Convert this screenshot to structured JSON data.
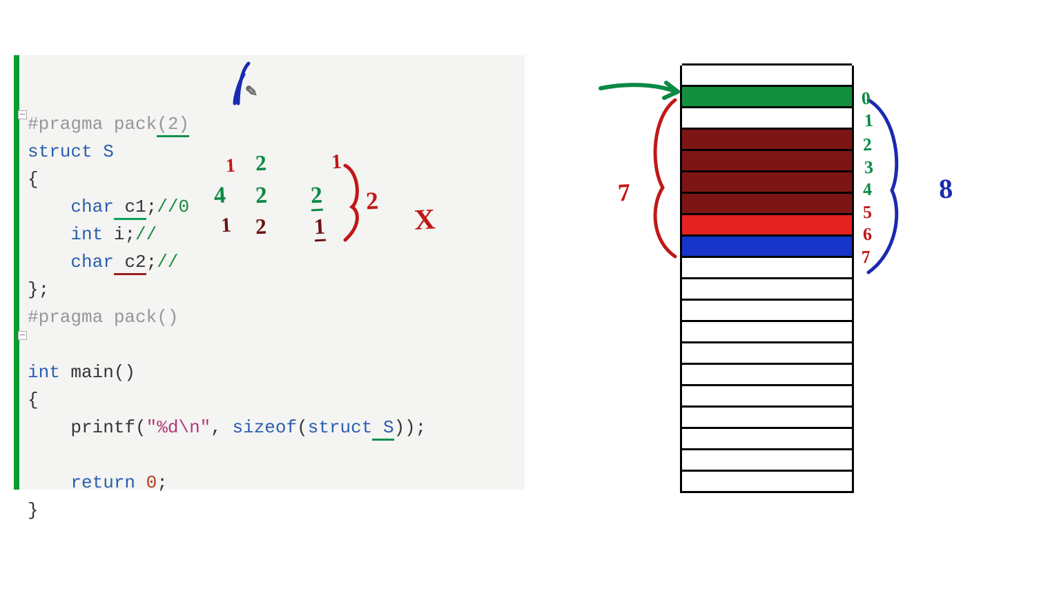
{
  "code": {
    "l1_pragma_open": "#pragma pack",
    "l1_pack_val": "(2)",
    "l2_struct_kw": "struct",
    "l2_struct_name": " S",
    "l3_open": "{",
    "l4_indent": "    ",
    "l4_type": "char",
    "l4_var": " c1",
    "l4_tail": ";",
    "l4_comment": "//0",
    "l5_indent": "    ",
    "l5_type": "int",
    "l5_var": " i;",
    "l5_comment": "//",
    "l6_indent": "    ",
    "l6_type": "char",
    "l6_var": " c2",
    "l6_tail": ";",
    "l6_comment": "//",
    "l7_close": "};",
    "l8_pragma_close": "#pragma pack()",
    "l10_int": "int",
    "l10_main": " main()",
    "l11_open": "{",
    "l12_indent": "    ",
    "l12_printf": "printf",
    "l12_open": "(",
    "l12_fmt": "\"%d\\n\"",
    "l12_comma": ", ",
    "l12_sizeof": "sizeof",
    "l12_p2": "(",
    "l12_struct": "struct",
    "l12_s": " S",
    "l12_tail": "));",
    "l14_indent": "    ",
    "l14_return": "return",
    "l14_zero": " 0",
    "l14_semi": ";",
    "l15_close": "}"
  },
  "annotations": {
    "c1_col1": "1",
    "c1_col2": "2",
    "c1_col3_top": "1",
    "i_col1": "4",
    "i_col2": "2",
    "i_col3": "2",
    "c2_col1": "1",
    "c2_col2": "2",
    "c2_col3": "1",
    "brace_result": "2",
    "cross": "X",
    "cursor_pen": "✎",
    "left_seven": "7",
    "right_eight": "8",
    "mem0": "0",
    "mem1": "1",
    "mem2": "2",
    "mem3": "3",
    "mem4": "4",
    "mem5": "5",
    "mem6": "6",
    "mem7": "7"
  },
  "memory": {
    "rows": 20,
    "fills": [
      "",
      "green",
      "",
      "darkred",
      "darkred",
      "darkred",
      "darkred",
      "red",
      "blue",
      "",
      "",
      "",
      "",
      "",
      "",
      "",
      "",
      "",
      "",
      ""
    ]
  },
  "colors": {
    "accent_green": "#0b9b2e",
    "hand_red": "#c01818",
    "hand_green": "#0a8a44",
    "hand_blue": "#1a2ab0"
  }
}
